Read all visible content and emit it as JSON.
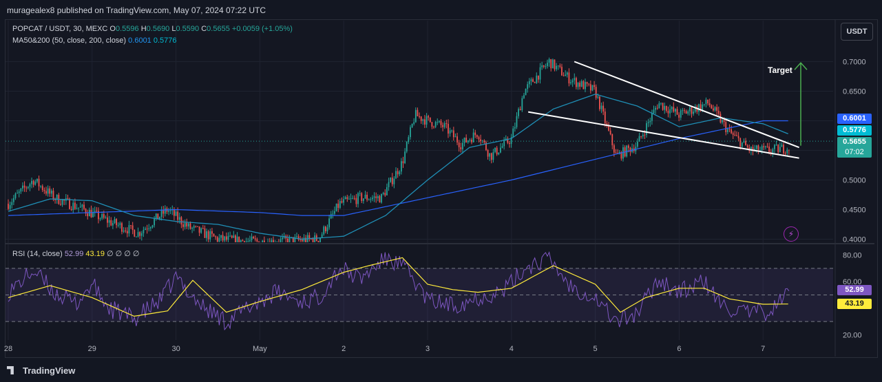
{
  "header": {
    "published": "muragealex8 published on TradingView.com, May 07, 2024 07:22 UTC"
  },
  "legend": {
    "symbol": "POPCAT / USDT, 30, MEXC",
    "open_label": "O",
    "open": "0.5596",
    "high_label": "H",
    "high": "0.5690",
    "low_label": "L",
    "low": "0.5590",
    "close_label": "C",
    "close": "0.5655",
    "change": "+0.0059 (+1.05%)",
    "ma_label": "MA50&200 (50, close, 200, close)",
    "ma50": "0.6001",
    "ma200": "0.5776",
    "rsi_label": "RSI (14, close)",
    "rsi": "52.99",
    "rsi_ma": "43.19",
    "rsi_extra": "∅ ∅ ∅ ∅"
  },
  "currency_button": "USDT",
  "annotation": {
    "target": "Target"
  },
  "price_tags": {
    "ma50": "0.6001",
    "ma200": "0.5776",
    "last": "0.5655",
    "countdown": "07:02",
    "rsi": "52.99",
    "rsi_ma": "43.19"
  },
  "footer": {
    "brand": "TradingView"
  },
  "colors": {
    "up": "#26a69a",
    "down": "#ef5350",
    "ma50": "#2962ff",
    "ma200": "#00bcd4",
    "rsi": "#7e57c2",
    "rsi_ma": "#ffeb3b",
    "target_arrow": "#4caf50",
    "trendline": "#ffffff"
  },
  "chart_data": [
    {
      "type": "candlestick",
      "title": "POPCAT / USDT, 30, MEXC",
      "x_ticks": [
        "28",
        "29",
        "30",
        "May",
        "2",
        "3",
        "4",
        "5",
        "6",
        "7"
      ],
      "y_ticks": [
        "0.7000",
        "0.6500",
        "0.6000",
        "0.5500",
        "0.5000",
        "0.4500",
        "0.4000"
      ],
      "ylim": [
        0.4,
        0.72
      ],
      "anchors_price": [
        [
          0,
          0.46
        ],
        [
          0.3,
          0.5
        ],
        [
          0.55,
          0.47
        ],
        [
          0.9,
          0.45
        ],
        [
          1.2,
          0.43
        ],
        [
          1.55,
          0.41
        ],
        [
          1.9,
          0.45
        ],
        [
          2.15,
          0.42
        ],
        [
          2.5,
          0.4
        ],
        [
          3.0,
          0.395
        ],
        [
          3.7,
          0.4
        ],
        [
          3.95,
          0.46
        ],
        [
          4.2,
          0.47
        ],
        [
          4.45,
          0.47
        ],
        [
          4.7,
          0.53
        ],
        [
          4.85,
          0.61
        ],
        [
          5.0,
          0.6
        ],
        [
          5.2,
          0.59
        ],
        [
          5.4,
          0.56
        ],
        [
          5.6,
          0.58
        ],
        [
          5.75,
          0.54
        ],
        [
          6.0,
          0.57
        ],
        [
          6.15,
          0.65
        ],
        [
          6.45,
          0.7
        ],
        [
          6.7,
          0.67
        ],
        [
          7.0,
          0.65
        ],
        [
          7.25,
          0.54
        ],
        [
          7.5,
          0.56
        ],
        [
          7.75,
          0.63
        ],
        [
          8.0,
          0.61
        ],
        [
          8.35,
          0.63
        ],
        [
          8.6,
          0.58
        ],
        [
          8.85,
          0.55
        ],
        [
          9.1,
          0.55
        ],
        [
          9.3,
          0.555
        ]
      ],
      "ma50_anchors": [
        [
          0,
          0.447
        ],
        [
          0.5,
          0.468
        ],
        [
          1.0,
          0.465
        ],
        [
          1.5,
          0.44
        ],
        [
          2.0,
          0.43
        ],
        [
          2.5,
          0.425
        ],
        [
          3.0,
          0.41
        ],
        [
          3.5,
          0.4
        ],
        [
          4.0,
          0.405
        ],
        [
          4.5,
          0.44
        ],
        [
          5.0,
          0.5
        ],
        [
          5.5,
          0.555
        ],
        [
          6.0,
          0.57
        ],
        [
          6.5,
          0.62
        ],
        [
          7.0,
          0.645
        ],
        [
          7.5,
          0.625
        ],
        [
          8.0,
          0.59
        ],
        [
          8.5,
          0.605
        ],
        [
          9.0,
          0.595
        ],
        [
          9.3,
          0.578
        ]
      ],
      "ma200_anchors": [
        [
          0,
          0.44
        ],
        [
          1.0,
          0.445
        ],
        [
          2.0,
          0.45
        ],
        [
          3.0,
          0.445
        ],
        [
          3.5,
          0.44
        ],
        [
          4.0,
          0.44
        ],
        [
          4.5,
          0.455
        ],
        [
          5.0,
          0.47
        ],
        [
          6.0,
          0.5
        ],
        [
          7.0,
          0.535
        ],
        [
          8.0,
          0.57
        ],
        [
          9.0,
          0.6
        ],
        [
          9.3,
          0.6
        ]
      ],
      "trendlines": [
        {
          "from": [
            6.75,
            0.7
          ],
          "to": [
            9.43,
            0.555
          ]
        },
        {
          "from": [
            6.2,
            0.615
          ],
          "to": [
            9.43,
            0.537
          ]
        }
      ],
      "target_arrow": {
        "x": 9.45,
        "from": 0.558,
        "to": 0.698
      }
    },
    {
      "type": "line",
      "title": "RSI (14, close)",
      "y_ticks": [
        "80.00",
        "60.00",
        "20.00"
      ],
      "ylim": [
        14,
        86
      ],
      "bands": [
        70,
        50,
        30
      ],
      "series": [
        {
          "name": "RSI",
          "anchors": [
            [
              0,
              52
            ],
            [
              0.3,
              68
            ],
            [
              0.55,
              52
            ],
            [
              0.8,
              43
            ],
            [
              1.0,
              58
            ],
            [
              1.2,
              40
            ],
            [
              1.5,
              32
            ],
            [
              1.8,
              45
            ],
            [
              2.0,
              63
            ],
            [
              2.3,
              42
            ],
            [
              2.6,
              30
            ],
            [
              2.9,
              42
            ],
            [
              3.2,
              52
            ],
            [
              3.5,
              45
            ],
            [
              3.7,
              48
            ],
            [
              3.95,
              70
            ],
            [
              4.2,
              62
            ],
            [
              4.5,
              78
            ],
            [
              4.7,
              72
            ],
            [
              4.85,
              60
            ],
            [
              5.0,
              46
            ],
            [
              5.3,
              42
            ],
            [
              5.6,
              48
            ],
            [
              5.9,
              53
            ],
            [
              6.2,
              72
            ],
            [
              6.45,
              77
            ],
            [
              6.7,
              57
            ],
            [
              7.0,
              48
            ],
            [
              7.25,
              30
            ],
            [
              7.5,
              36
            ],
            [
              7.75,
              62
            ],
            [
              8.0,
              52
            ],
            [
              8.3,
              60
            ],
            [
              8.5,
              42
            ],
            [
              8.8,
              36
            ],
            [
              9.1,
              38
            ],
            [
              9.3,
              52.99
            ]
          ]
        },
        {
          "name": "RSI-based MA",
          "anchors": [
            [
              0,
              48
            ],
            [
              0.5,
              57
            ],
            [
              1.0,
              48
            ],
            [
              1.5,
              34
            ],
            [
              1.9,
              38
            ],
            [
              2.2,
              61
            ],
            [
              2.6,
              37
            ],
            [
              3.0,
              45
            ],
            [
              3.5,
              54
            ],
            [
              4.0,
              67
            ],
            [
              4.3,
              72
            ],
            [
              4.7,
              78
            ],
            [
              5.0,
              58
            ],
            [
              5.3,
              54
            ],
            [
              5.6,
              52
            ],
            [
              6.0,
              55
            ],
            [
              6.5,
              72
            ],
            [
              7.0,
              58
            ],
            [
              7.3,
              37
            ],
            [
              7.6,
              48
            ],
            [
              8.0,
              55
            ],
            [
              8.3,
              55
            ],
            [
              8.6,
              47
            ],
            [
              9.0,
              43
            ],
            [
              9.3,
              43.19
            ]
          ]
        }
      ]
    }
  ]
}
